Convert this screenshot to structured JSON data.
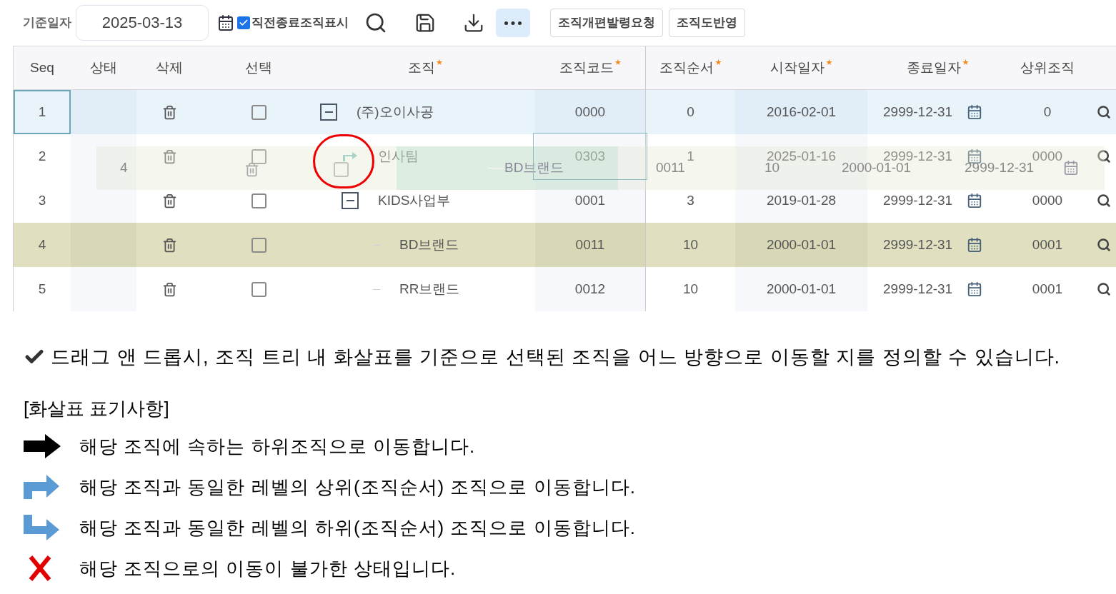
{
  "toolbar": {
    "date_label": "기준일자",
    "date_value": "2025-03-13",
    "show_closed": {
      "label": "직전종료조직표시",
      "checked": true
    },
    "buttons": [
      "조직개편발령요청",
      "조직도반영"
    ]
  },
  "grid": {
    "columns": [
      {
        "label": "Seq",
        "required": false
      },
      {
        "label": "상태",
        "required": false
      },
      {
        "label": "삭제",
        "required": false
      },
      {
        "label": "선택",
        "required": false
      },
      {
        "label": "조직",
        "required": true
      },
      {
        "label": "조직코드",
        "required": true
      },
      {
        "label": "조직순서",
        "required": true
      },
      {
        "label": "시작일자",
        "required": true
      },
      {
        "label": "종료일자",
        "required": true
      },
      {
        "label": "상위조직",
        "required": false
      }
    ],
    "drop_arrow": {
      "kind": "up"
    },
    "rows": [
      {
        "seq": "1",
        "name": "(주)오이사공",
        "code": "0000",
        "order": "0",
        "start": "2016-02-01",
        "end": "2999-12-31",
        "parent": "0",
        "selected": true,
        "dragging": false,
        "drop_target": false,
        "checked": false,
        "expanded": true,
        "children": [
          {
            "seq": "2",
            "name": "인사팀",
            "code": "0303",
            "order": "1",
            "start": "2025-01-16",
            "end": "2999-12-31",
            "parent": "0000",
            "selected": false,
            "dragging": false,
            "drop_target": true,
            "checked": false
          },
          {
            "seq": "3",
            "name": "KIDS사업부",
            "code": "0001",
            "order": "3",
            "start": "2019-01-28",
            "end": "2999-12-31",
            "parent": "0000",
            "selected": false,
            "dragging": false,
            "drop_target": false,
            "checked": false,
            "expanded": true,
            "children": [
              {
                "seq": "4",
                "name": "BD브랜드",
                "code": "0011",
                "order": "10",
                "start": "2000-01-01",
                "end": "2999-12-31",
                "parent": "0001",
                "selected": false,
                "dragging": true,
                "drop_target": false,
                "checked": false
              },
              {
                "seq": "5",
                "name": "RR브랜드",
                "code": "0012",
                "order": "10",
                "start": "2000-01-01",
                "end": "2999-12-31",
                "parent": "0001",
                "selected": false,
                "dragging": false,
                "drop_target": false,
                "checked": false
              }
            ]
          }
        ]
      }
    ],
    "drag_ghost": {
      "checked": false,
      "seq": "4",
      "name": "BD브랜드",
      "code": "0011",
      "order": "10",
      "start": "2000-01-01",
      "end": "2999-12-31"
    }
  },
  "note": "드래그 앤 드롭시, 조직 트리 내 화살표를 기준으로 선택된 조직을 어느 방향으로 이동할 지를 정의할 수 있습니다.",
  "legend": {
    "title": "[화살표 표기사항]",
    "items": [
      {
        "kind": "right",
        "text": "해당 조직에 속하는 하위조직으로 이동합니다."
      },
      {
        "kind": "up",
        "text": "해당 조직과 동일한 레벨의 상위(조직순서) 조직으로 이동합니다."
      },
      {
        "kind": "down",
        "text": "해당 조직과 동일한 레벨의 하위(조직순서) 조직으로 이동합니다."
      },
      {
        "kind": "blocked",
        "text": "해당 조직으로의 이동이 불가한 상태입니다."
      }
    ]
  }
}
